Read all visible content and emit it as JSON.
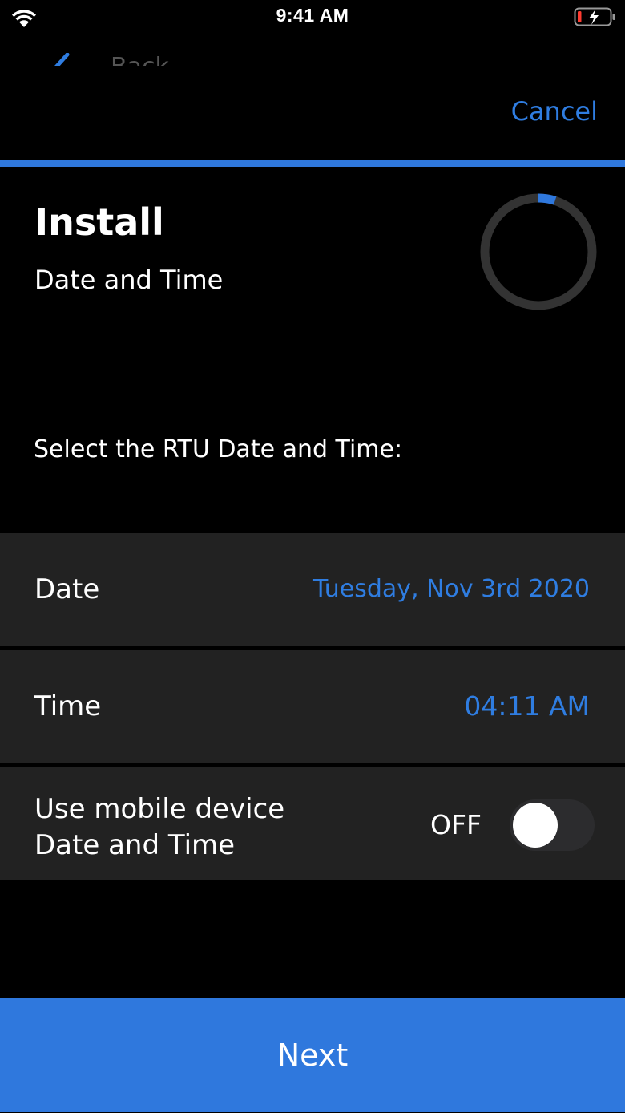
{
  "status_bar": {
    "time": "9:41 AM",
    "wifi_icon": "wifi-icon",
    "battery_icon": "battery-charging-icon"
  },
  "nav": {
    "back_label": "Back",
    "cancel_label": "Cancel"
  },
  "header": {
    "title": "Install",
    "subtitle": "Date and Time",
    "progress": 0.05
  },
  "instruction": "Select the RTU Date and Time:",
  "rows": {
    "date": {
      "label": "Date",
      "value": "Tuesday, Nov 3rd 2020"
    },
    "time": {
      "label": "Time",
      "value": "04:11 AM"
    },
    "mobile": {
      "label_line1": "Use mobile device",
      "label_line2": "Date and Time",
      "state": "OFF",
      "on": false
    }
  },
  "footer": {
    "next_label": "Next"
  },
  "colors": {
    "accent": "#2f78dd",
    "link": "#2f7de1",
    "row_bg": "#222222",
    "background": "#000000"
  }
}
